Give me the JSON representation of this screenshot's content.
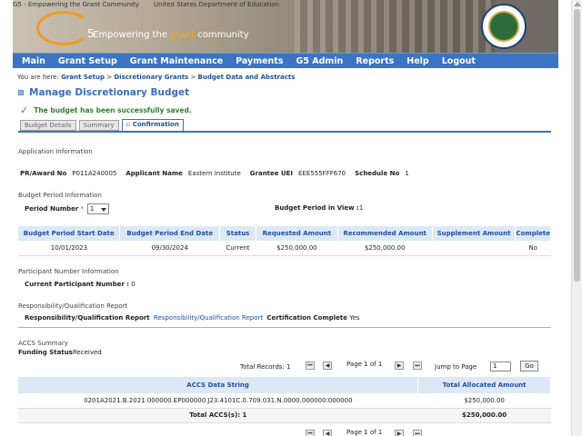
{
  "header": {
    "banner_alt": "G5 - Empowering the Grant Community",
    "seal_alt": "United States Department of Education",
    "logo_text": "5",
    "tagline_prefix": "Empowering the ",
    "tagline_highlight": "grant",
    "tagline_suffix": " community"
  },
  "nav": [
    "Main",
    "Grant Setup",
    "Grant Maintenance",
    "Payments",
    "G5 Admin",
    "Reports",
    "Help",
    "Logout"
  ],
  "breadcrumb": {
    "prefix": "You are here: ",
    "items": [
      "Grant Setup",
      "Discretionary Grants",
      "Budget Data and Abstracts"
    ],
    "separator": " > "
  },
  "page_title": "Manage Discretionary Budget",
  "success_message": "The budget has been successfully saved.",
  "tabs": [
    "Budget Details",
    "Summary",
    "Confirmation"
  ],
  "application": {
    "section": "Application Information",
    "award_label": "PR/Award No",
    "award_value": "P011A240005",
    "applicant_label": "Applicant Name",
    "applicant_value": "Eastern Institute",
    "uei_label": "Grantee UEI",
    "uei_value": "EEE555FFF670",
    "schedule_label": "Schedule No",
    "schedule_value": "1"
  },
  "budget_period": {
    "section": "Budget Period Information",
    "period_label": "Period Number",
    "required_mark": "*",
    "period_value": "1",
    "in_view_label": "Budget Period in View :",
    "in_view_value": "1",
    "columns": [
      "Budget Period Start Date",
      "Budget Period End Date",
      "Status",
      "Requested Amount",
      "Recommended Amount",
      "Supplement Amount",
      "Complete"
    ],
    "rows": [
      [
        "10/01/2023",
        "09/30/2024",
        "Current",
        "$250,000.00",
        "$250,000.00",
        "",
        "No"
      ]
    ]
  },
  "participant": {
    "section": "Participant Number Information",
    "label": "Current Participant Number :",
    "value": "0"
  },
  "responsibility": {
    "section": "Responsibility/Qualification Report",
    "label": "Responsibility/Qualification Report",
    "link": "Responsibility/Qualification Report",
    "cert_label": "Certification Complete",
    "cert_value": "Yes"
  },
  "accs": {
    "section": "ACCS Summary",
    "funding_label": "Funding Status",
    "funding_value": "Received",
    "pager": {
      "total_records": "Total Records: 1",
      "page_of": "Page 1 of 1",
      "jump_label": "Jump to Page",
      "jump_value": "1",
      "go": "Go",
      "first": "⏮",
      "prev": "◀",
      "next": "▶",
      "last": "⏭"
    },
    "columns": [
      "ACCS Data String",
      "Total Allocated Amount"
    ],
    "rows": [
      [
        "0201A2021.B.2021.000000.EP000000.J23.4101C.0.709.031.N.0000.000000.000000",
        "$250,000.00"
      ]
    ],
    "total_label": "Total ACCS(s): 1",
    "total_value": "$250,000.00"
  }
}
